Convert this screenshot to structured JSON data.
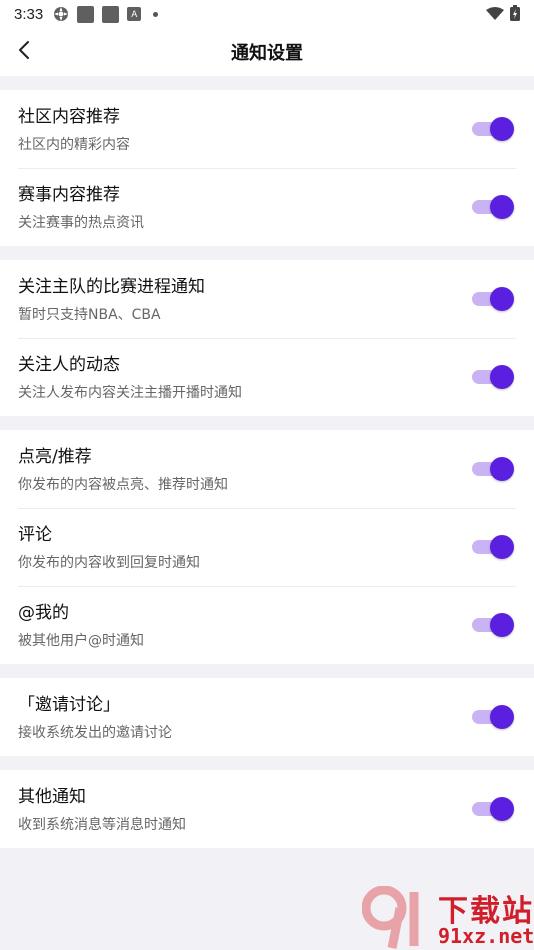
{
  "status_bar": {
    "time": "3:33",
    "icons": [
      "settings-gear-icon",
      "app-square-icon",
      "app-square-icon",
      "app-a-icon",
      "dot-icon"
    ],
    "right_icons": [
      "wifi-icon",
      "battery-icon"
    ]
  },
  "header": {
    "back_icon": "chevron-left-icon",
    "title": "通知设置"
  },
  "colors": {
    "accent": "#5b1fe0",
    "toggle_track": "#c9b3f4",
    "background": "#f2f2f6"
  },
  "groups": [
    {
      "items": [
        {
          "title": "社区内容推荐",
          "subtitle": "社区内的精彩内容",
          "enabled": true
        },
        {
          "title": "赛事内容推荐",
          "subtitle": "关注赛事的热点资讯",
          "enabled": true
        }
      ]
    },
    {
      "items": [
        {
          "title": "关注主队的比赛进程通知",
          "subtitle": "暂时只支持NBA、CBA",
          "enabled": true
        },
        {
          "title": "关注人的动态",
          "subtitle": "关注人发布内容关注主播开播时通知",
          "enabled": true
        }
      ]
    },
    {
      "items": [
        {
          "title": "点亮/推荐",
          "subtitle": "你发布的内容被点亮、推荐时通知",
          "enabled": true
        },
        {
          "title": "评论",
          "subtitle": "你发布的内容收到回复时通知",
          "enabled": true
        },
        {
          "title": "@我的",
          "subtitle": "被其他用户@时通知",
          "enabled": true
        }
      ]
    },
    {
      "items": [
        {
          "title": "「邀请讨论」",
          "subtitle": "接收系统发出的邀请讨论",
          "enabled": true
        }
      ]
    },
    {
      "items": [
        {
          "title": "其他通知",
          "subtitle": "收到系统消息等消息时通知",
          "enabled": true
        }
      ]
    }
  ],
  "watermark": {
    "line1": "下载站",
    "line2": "91xz.net"
  }
}
